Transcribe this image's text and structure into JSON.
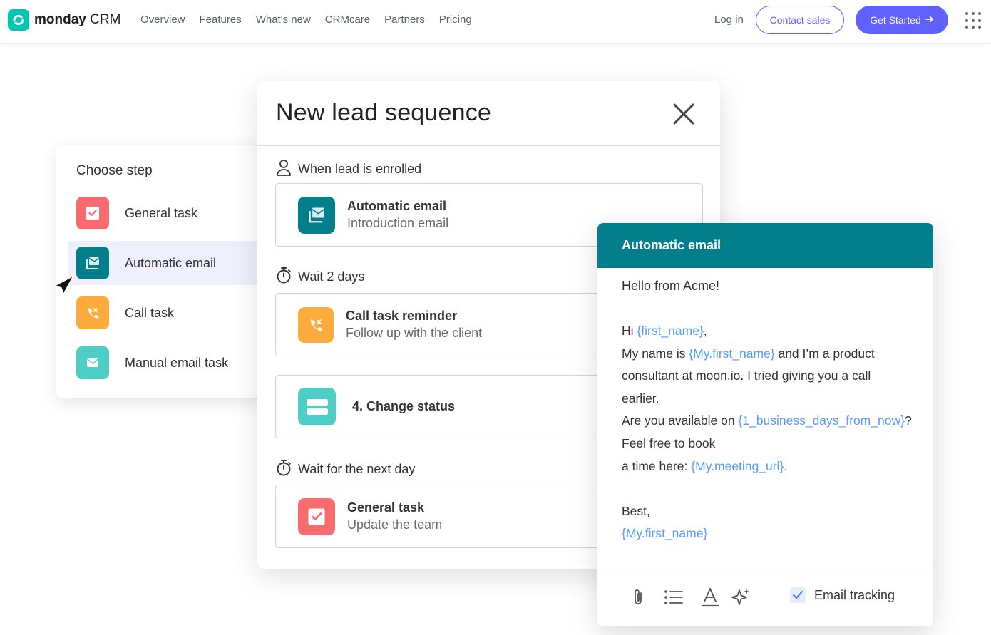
{
  "nav": {
    "brand_bold": "monday",
    "brand_light": " CRM",
    "links": [
      "Overview",
      "Features",
      "What's new",
      "CRMcare",
      "Partners",
      "Pricing"
    ],
    "login": "Log in",
    "contact_sales": "Contact sales",
    "get_started": "Get Started",
    "colors": {
      "accent": "#6161ff",
      "brand": "#00c8b0"
    }
  },
  "choose_step": {
    "title": "Choose step",
    "items": [
      {
        "label": "General task",
        "icon": "checkbox-icon",
        "color": "#fa6b70",
        "active": false
      },
      {
        "label": "Automatic email",
        "icon": "envelope-stack-icon",
        "color": "#037f8c",
        "active": true
      },
      {
        "label": "Call task",
        "icon": "phone-icon",
        "color": "#fdab3d",
        "active": false
      },
      {
        "label": "Manual email task",
        "icon": "mail-icon",
        "color": "#4eccc6",
        "active": false
      }
    ]
  },
  "sequence": {
    "title": "New lead sequence",
    "trigger_label": "When lead is enrolled",
    "steps": [
      {
        "title": "Automatic email",
        "subtitle": "Introduction email"
      },
      {
        "wait": "Wait 2 days",
        "title": "Call task reminder",
        "subtitle": "Follow up with the client"
      },
      {
        "title": "4. Change status"
      },
      {
        "wait": "Wait for the next day",
        "title": "General task",
        "subtitle": "Update the team"
      }
    ]
  },
  "email": {
    "header": "Automatic email",
    "subject": "Hello from Acme!",
    "body": {
      "hi": "Hi ",
      "first_name_var": "{first_name}",
      "comma": ",",
      "line2_a": "My name is ",
      "my_first_name_var": "{My.first_name}",
      "line2_b": " and I’m a product",
      "line3": "consultant at moon.io. I tried giving you a call",
      "line4": "earlier.",
      "line5_a": "Are you available on ",
      "days_var": "{1_business_days_from_now}",
      "line5_b": "?",
      "line6": "Feel free to book",
      "line7_a": "a time here: ",
      "meeting_var": "{My.meeting_url}.",
      "sign_off": "Best,",
      "signature_var": "{My.first_name}"
    },
    "toolbar_icons": [
      "paperclip-icon",
      "bullet-list-icon",
      "text-color-icon",
      "ai-sparkle-icon"
    ],
    "tracking_label": "Email tracking",
    "tracking_checked": true,
    "colors": {
      "header": "#037f8c",
      "variable": "#579bfc"
    }
  }
}
